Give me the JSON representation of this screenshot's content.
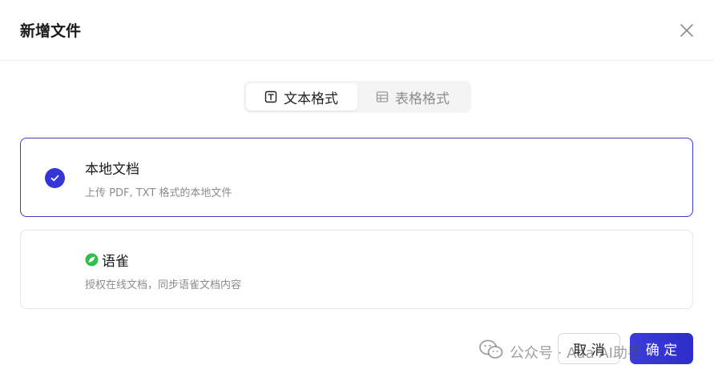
{
  "dialog": {
    "title": "新增文件",
    "close_icon": "close-icon"
  },
  "tabs": [
    {
      "label": "文本格式",
      "icon": "text-format-icon",
      "active": true
    },
    {
      "label": "表格格式",
      "icon": "table-format-icon",
      "active": false
    }
  ],
  "options": [
    {
      "title": "本地文档",
      "desc": "上传 PDF, TXT 格式的本地文件",
      "selected": true,
      "icon": "check-icon"
    },
    {
      "title": "语雀",
      "desc": "授权在线文档，同步语雀文档内容",
      "selected": false,
      "icon": "yuque-logo-icon"
    }
  ],
  "footer": {
    "cancel_label": "取 消",
    "ok_label": "确 定"
  },
  "watermark": {
    "text": "公众号 · Ada AI助手"
  },
  "colors": {
    "primary": "#3535d8",
    "selected_border": "#3c3cc8",
    "yuque_green": "#2fbf4a"
  }
}
